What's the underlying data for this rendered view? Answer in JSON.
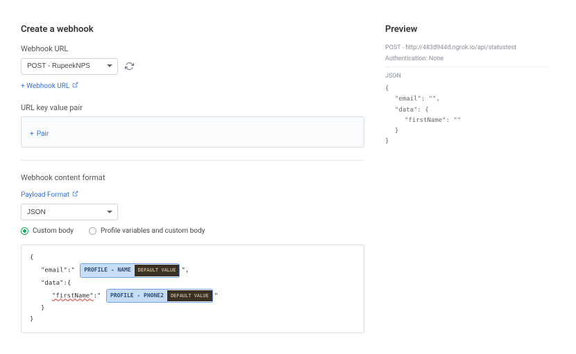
{
  "main": {
    "heading": "Create a webhook",
    "webhook_url_label": "Webhook URL",
    "webhook_url_select": "POST - RupeekNPS",
    "add_webhook_url": "+ Webhook URL",
    "url_kvp_label": "URL key value pair",
    "pair_btn": "Pair",
    "content_format_label": "Webhook content format",
    "payload_format_link": "Payload Format",
    "format_select": "JSON",
    "radio_custom": "Custom body",
    "radio_profile": "Profile variables and custom body",
    "code": {
      "email_key": "\"email\"",
      "data_key": "\"data\"",
      "firstname_key": "\"firstName\"",
      "chip1_main": "PROFILE - NAME",
      "chip1_badge": "DEFAULT VALUE",
      "chip2_main": "PROFILE - PHONE2",
      "chip2_badge": "DEFAULT VALUE"
    }
  },
  "preview": {
    "heading": "Preview",
    "method": "POST",
    "url": "http://483d944d.ngrok.io/api/statustest",
    "auth_label": "Authentication: None",
    "json_label": "JSON",
    "body": {
      "l1": "{",
      "l2": "\"email\": \"\",",
      "l3": "\"data\": {",
      "l4": "\"firstName\": \"\"",
      "l5": "}",
      "l6": "}"
    }
  },
  "chart_data": null
}
